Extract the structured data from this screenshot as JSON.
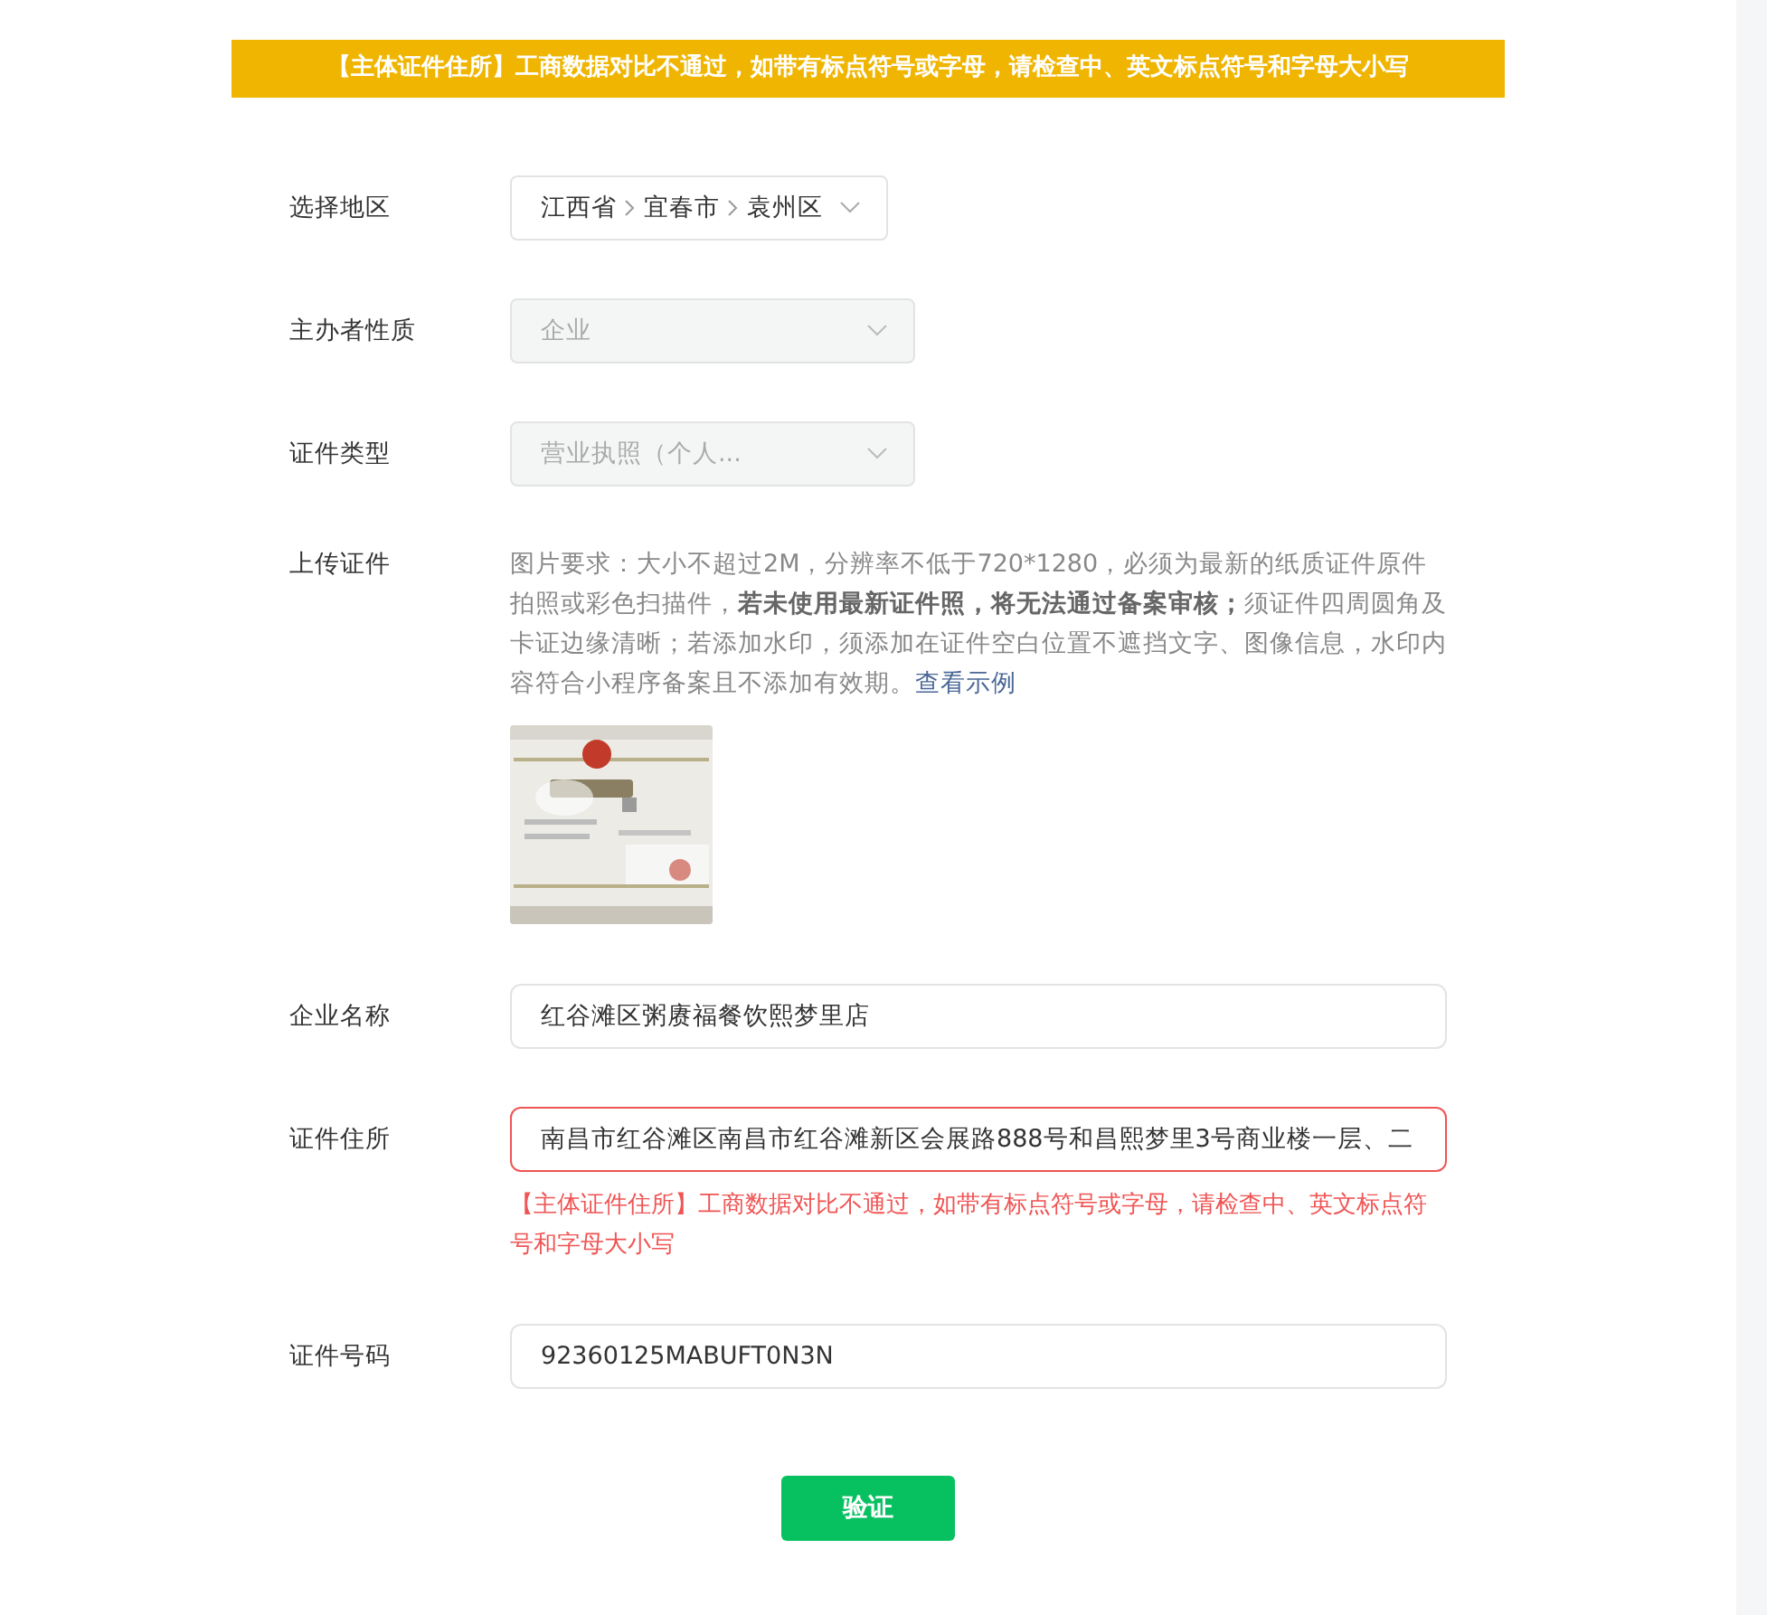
{
  "banner": {
    "text": "【主体证件住所】工商数据对比不通过，如带有标点符号或字母，请检查中、英文标点符号和字母大小写"
  },
  "fields": [
    {
      "kind": "cascader",
      "label": "选择地区",
      "segments": [
        "江西省",
        "宜春市",
        "袁州区"
      ],
      "disabled": false
    },
    {
      "kind": "select",
      "label": "主办者性质",
      "value": "企业",
      "disabled": true
    },
    {
      "kind": "select",
      "label": "证件类型",
      "value": "营业执照（个人...",
      "disabled": true
    },
    {
      "kind": "upload",
      "label": "上传证件",
      "description": "图片要求：大小不超过2M，分辨率不低于720*1280，必须为最新的纸质证件原件拍照或彩色扫描件，**若未使用最新证件照，将无法通过备案审核；**须证件四周圆角及卡证边缘清晰；若添加水印，须添加在证件空白位置不遮挡文字、图像信息，水印内容符合小程序备案且不添加有效期。",
      "link": "查看示例"
    },
    {
      "kind": "input",
      "label": "企业名称",
      "value": "红谷滩区粥赓福餐饮熙梦里店",
      "error": false
    },
    {
      "kind": "input",
      "label": "证件住所",
      "value": "南昌市红谷滩区南昌市红谷滩新区会展路888号和昌熙梦里3号商业楼一层、二",
      "error": true,
      "error_text": "【主体证件住所】工商数据对比不通过，如带有标点符号或字母，请检查中、英文标点符号和字母大小写"
    },
    {
      "kind": "input",
      "label": "证件号码",
      "value": "92360125MABUFT0N3N",
      "error": false
    }
  ],
  "submit": {
    "label": "验证"
  }
}
